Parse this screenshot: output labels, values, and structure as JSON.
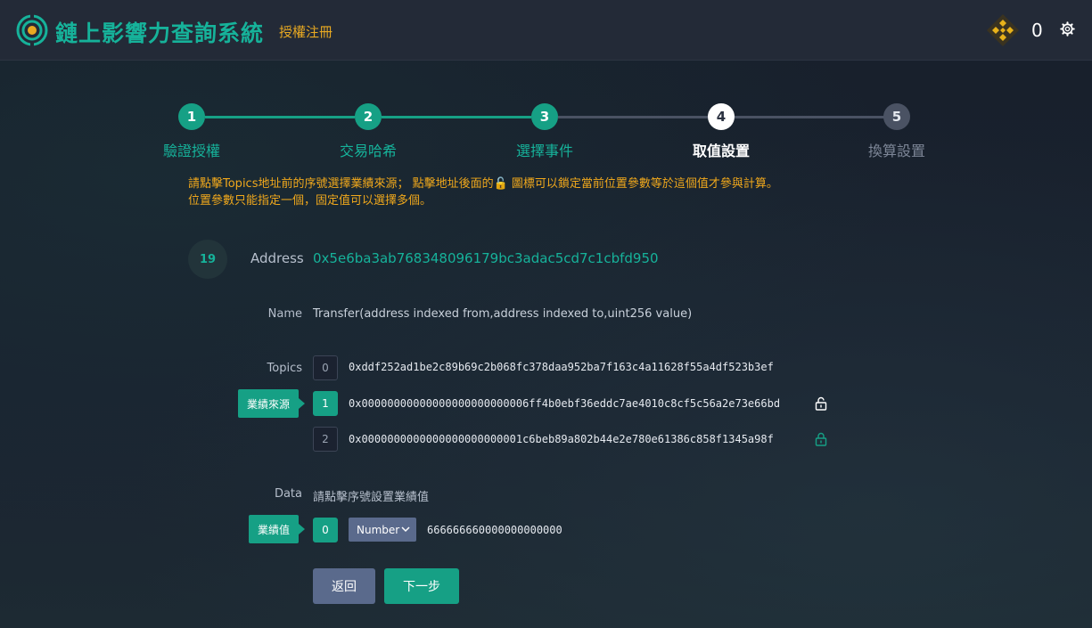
{
  "header": {
    "app_title": "鏈上影響力查詢系統",
    "nav_link": "授權注冊",
    "coin_count": "0"
  },
  "steps": [
    {
      "number": "1",
      "label": "驗證授權",
      "state": "done"
    },
    {
      "number": "2",
      "label": "交易哈希",
      "state": "done"
    },
    {
      "number": "3",
      "label": "選擇事件",
      "state": "done"
    },
    {
      "number": "4",
      "label": "取值設置",
      "state": "current"
    },
    {
      "number": "5",
      "label": "換算設置",
      "state": "pending"
    }
  ],
  "notice": {
    "line1": "請點擊Topics地址前的序號選擇業績來源； 點擊地址後面的🔓 圖標可以鎖定當前位置參數等於這個值才參與計算。",
    "line2": "位置參數只能指定一個，固定值可以選擇多個。"
  },
  "event": {
    "badge": "19",
    "address_label": "Address",
    "address": "0x5e6ba3ab768348096179bc3adac5cd7c1cbfd950",
    "name_label": "Name",
    "name": "Transfer(address indexed from,address indexed to,uint256 value)",
    "topics_label": "Topics",
    "topics": [
      {
        "index": "0",
        "value": "0xddf252ad1be2c89b69c2b068fc378daa952ba7f163c4a11628f55a4df523b3ef"
      },
      {
        "index": "1",
        "value": "0x00000000000000000000000006ff4b0ebf36eddc7ae4010c8cf5c56a2e73e66bd"
      },
      {
        "index": "2",
        "value": "0x0000000000000000000000001c6beb89a802b44e2e780e61386c858f1345a98f"
      }
    ],
    "source_tag": "業績來源",
    "data_label": "Data",
    "data_hint": "請點擊序號設置業績值",
    "value_tag": "業績值",
    "data_index": "0",
    "data_type": "Number",
    "data_value": "666666660000000000000"
  },
  "buttons": {
    "back": "返回",
    "next": "下一步"
  },
  "colors": {
    "accent": "#16a085",
    "warning": "#f0a81c",
    "secondary_button": "#5a6a8c"
  }
}
